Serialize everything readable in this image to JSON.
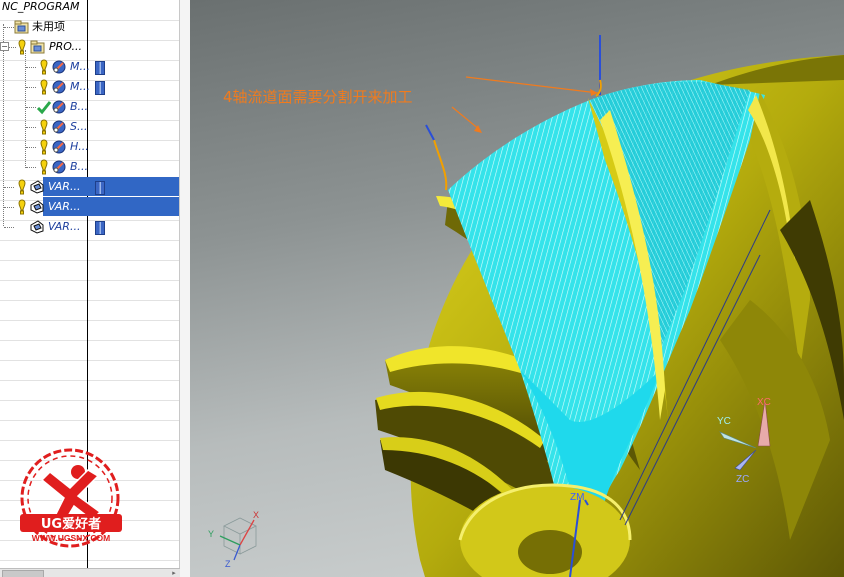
{
  "navigator": {
    "root_label": "NC_PROGRAM",
    "unused_label": "未用项",
    "program_label": "PRO...",
    "operations": [
      {
        "label": "M...",
        "status": "warning",
        "selected": false
      },
      {
        "label": "M...",
        "status": "warning",
        "selected": false
      },
      {
        "label": "B...",
        "status": "complete",
        "selected": false
      },
      {
        "label": "S...",
        "status": "warning",
        "selected": false
      },
      {
        "label": "H...",
        "status": "warning",
        "selected": false
      },
      {
        "label": "B...",
        "status": "warning",
        "selected": false
      },
      {
        "label": "VAR...",
        "status": "warning",
        "selected": true
      },
      {
        "label": "VAR...",
        "status": "warning",
        "selected": true
      },
      {
        "label": "VAR...",
        "status": "none",
        "selected": false
      }
    ]
  },
  "viewport": {
    "annotation": "4轴流道面需要分割开来加工",
    "triad_main": {
      "x": "XC",
      "y": "YC",
      "z": "ZC"
    },
    "triad_part": {
      "z": "ZM"
    },
    "triad_corner": {
      "x": "X",
      "y": "Y",
      "z": "Z"
    }
  },
  "watermark": {
    "brand": "UG爱好者",
    "url": "WWW.UGSNX.COM"
  },
  "colors": {
    "selection": "#3167c5",
    "part": "#c9c012",
    "toolpath": "#2fe6ef",
    "annotation": "#f07b1e",
    "watermark": "#e01e1e"
  }
}
